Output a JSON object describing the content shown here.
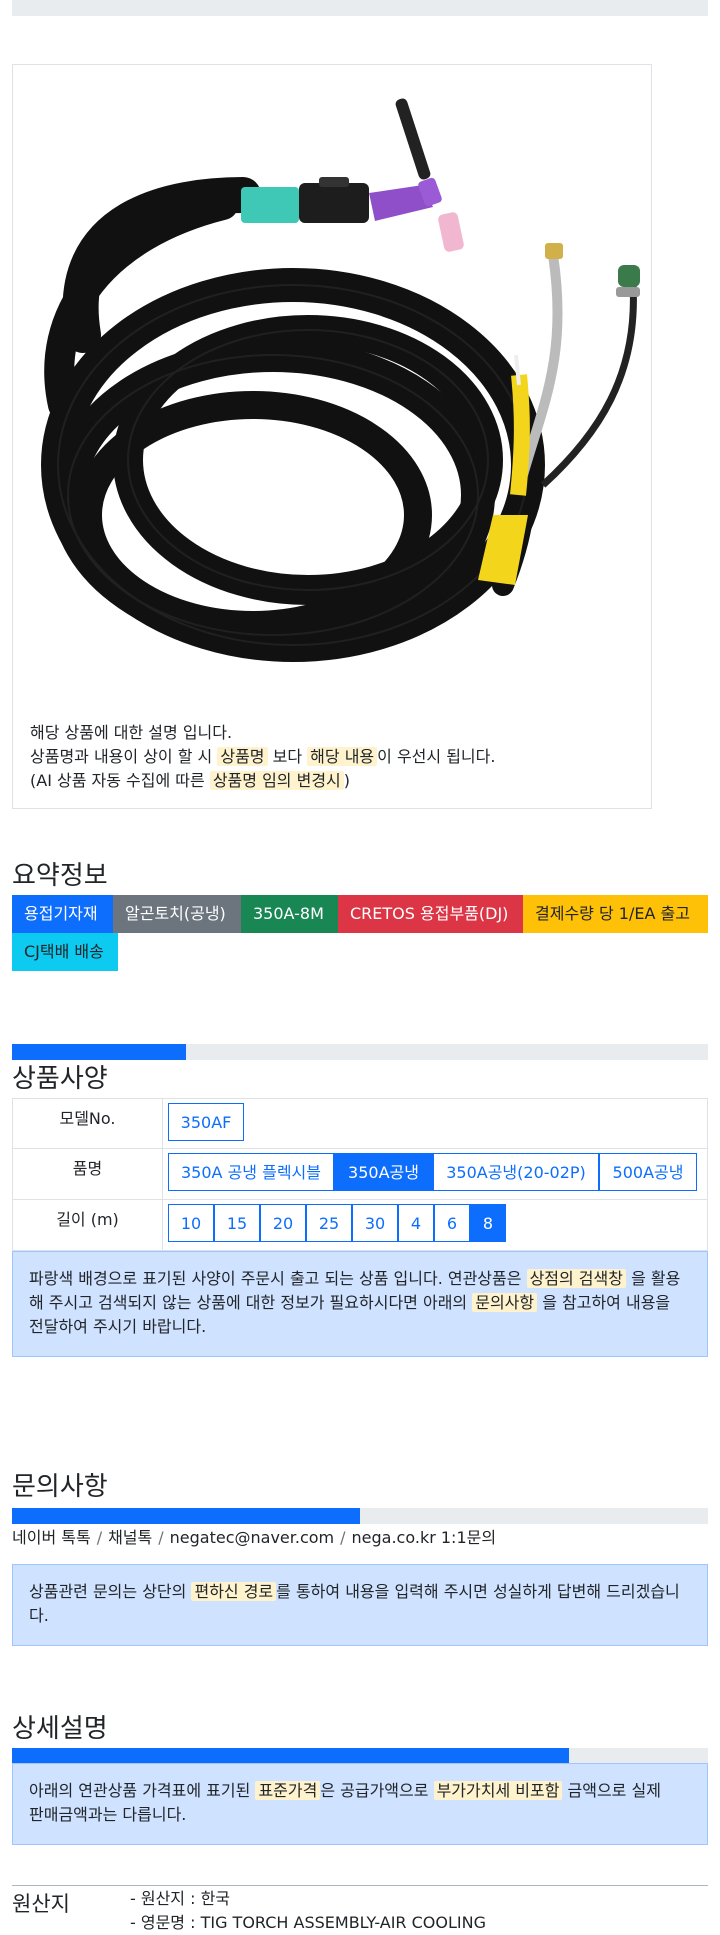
{
  "card": {
    "line1": "해당 상품에 대한 설명 입니다.",
    "line2_a": "상품명과 내용이 상이 할 시",
    "line2_hl1": "상품명",
    "line2_b": "보다",
    "line2_hl2": "해당 내용",
    "line2_c": "이 우선시 됩니다.",
    "line3_a": "(AI 상품 자동 수집에 따른",
    "line3_hl": "상품명 임의 변경시",
    "line3_b": ")"
  },
  "summary": {
    "title": "요약정보",
    "badges": [
      {
        "label": "용접기자재",
        "color": "#0d6efd"
      },
      {
        "label": "알곤토치(공냉)",
        "color": "#6c757d"
      },
      {
        "label": "350A-8M",
        "color": "#198754"
      },
      {
        "label": "CRETOS 용접부품(DJ)",
        "color": "#dc3545"
      },
      {
        "label": "결제수량 당 1/EA 출고",
        "color": "#ffc107"
      },
      {
        "label": "CJ택배 배송",
        "color": "#0dcaf0"
      }
    ]
  },
  "spec": {
    "title": "상품사양",
    "progress": 0.25,
    "rows": [
      {
        "label": "모델No.",
        "options": [
          "350AF"
        ],
        "selected": -1
      },
      {
        "label": "품명",
        "options": [
          "350A 공냉 플렉시블",
          "350A공냉",
          "350A공냉(20-02P)",
          "500A공냉"
        ],
        "selected": 1
      },
      {
        "label": "길이 (m)",
        "options": [
          "10",
          "15",
          "20",
          "25",
          "30",
          "4",
          "6",
          "8"
        ],
        "selected": 7
      }
    ],
    "notice_a": "파랑색 배경으로 표기된 사양이 주문시 출고 되는 상품 입니다. 연관상품은",
    "notice_hl1": "상점의 검색창",
    "notice_b": "을 활용",
    "notice_c": "해 주시고 검색되지 않는 상품에 대한 정보가 필요하시다면 아래의",
    "notice_hl2": "문의사항",
    "notice_d": "을 참고하여 내용을",
    "notice_e": "전달하여 주시기 바랍니다."
  },
  "inquiry": {
    "title": "문의사항",
    "progress": 0.5,
    "channels": [
      "네이버 톡톡",
      "채널톡",
      "negatec@naver.com",
      "nega.co.kr 1:1문의"
    ],
    "notice_a": "상품관련 문의는 상단의",
    "notice_hl": "편하신 경로",
    "notice_b": "를 통하여 내용을 입력해 주시면 성실하게 답변해 드리겠습니",
    "notice_c": "다."
  },
  "detail": {
    "title": "상세설명",
    "progress": 0.8,
    "notice_a": "아래의 연관상품 가격표에 표기된",
    "notice_hl1": "표준가격",
    "notice_b": "은 공급가액으로",
    "notice_hl2": "부가가치세 비포함",
    "notice_c": "금액으로 실제",
    "notice_d": "판매금액과는 다릅니다."
  },
  "origin": {
    "label": "원산지",
    "line1": "- 원산지 : 한국",
    "line2": "- 영문명 : TIG TORCH ASSEMBLY-AIR COOLING"
  },
  "icons": {
    "product_image": "tig-torch-photo"
  }
}
